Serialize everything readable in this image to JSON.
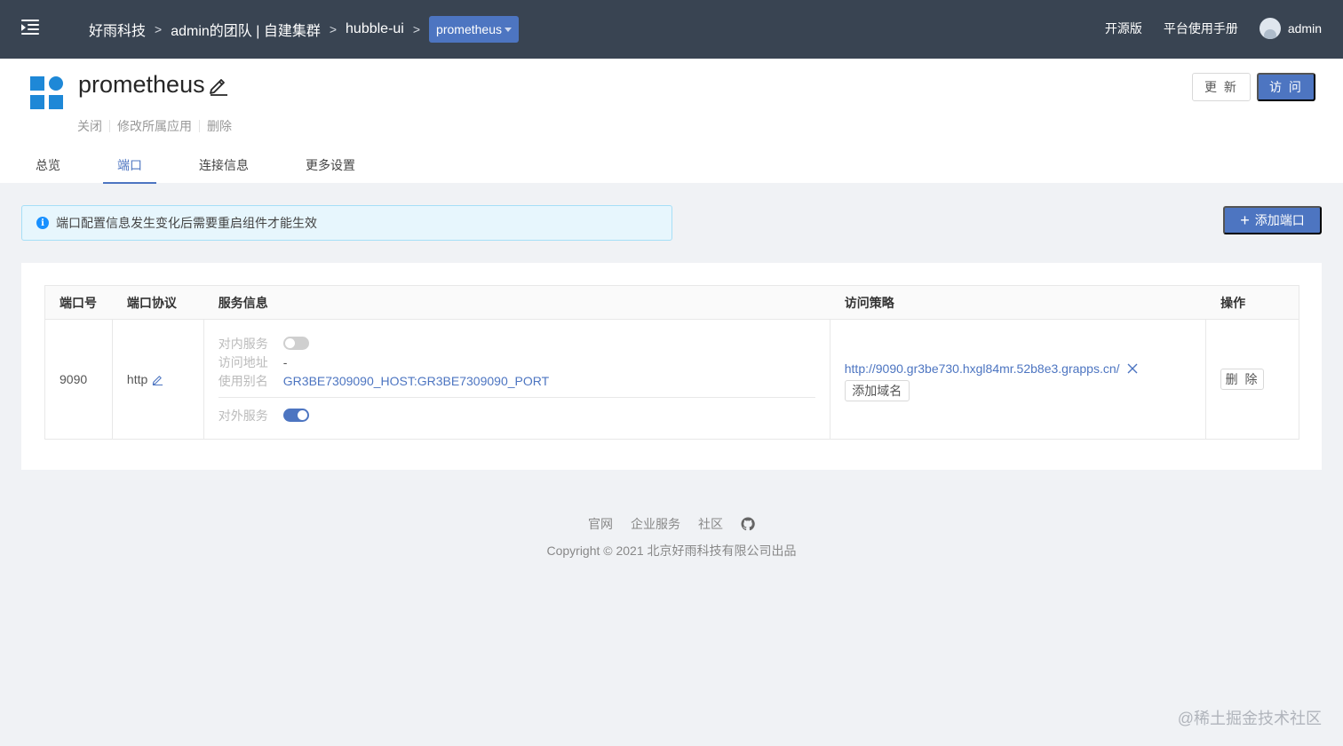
{
  "topbar": {
    "breadcrumbs": [
      "好雨科技",
      "admin的团队 | 自建集群",
      "hubble-ui"
    ],
    "separator": ">",
    "current": "prometheus",
    "nav_links": [
      "开源版",
      "平台使用手册"
    ],
    "username": "admin"
  },
  "app": {
    "name": "prometheus",
    "actions": [
      "关闭",
      "修改所属应用",
      "删除"
    ],
    "update_label": "更 新",
    "visit_label": "访 问"
  },
  "tabs": [
    "总览",
    "端口",
    "连接信息",
    "更多设置"
  ],
  "active_tab": "端口",
  "alert": {
    "text": "端口配置信息发生变化后需要重启组件才能生效"
  },
  "add_port_label": "添加端口",
  "table": {
    "headers": [
      "端口号",
      "端口协议",
      "服务信息",
      "访问策略",
      "操作"
    ],
    "rows": [
      {
        "port": "9090",
        "protocol": "http",
        "inner_service_label": "对内服务",
        "inner_service_on": false,
        "access_address_label": "访问地址",
        "access_address": "-",
        "alias_label": "使用别名",
        "alias": "GR3BE7309090_HOST:GR3BE7309090_PORT",
        "outer_service_label": "对外服务",
        "outer_service_on": true,
        "access_url": "http://9090.gr3be730.hxgl84mr.52b8e3.grapps.cn/",
        "add_domain_label": "添加域名",
        "delete_label": "删 除"
      }
    ]
  },
  "footer": {
    "links": [
      "官网",
      "企业服务",
      "社区"
    ],
    "copyright": "Copyright © 2021 北京好雨科技有限公司出品"
  },
  "watermark": "@稀土掘金技术社区",
  "colors": {
    "topbar": "#394452",
    "accent": "#4d75c1",
    "logo": "#1e88d7"
  }
}
